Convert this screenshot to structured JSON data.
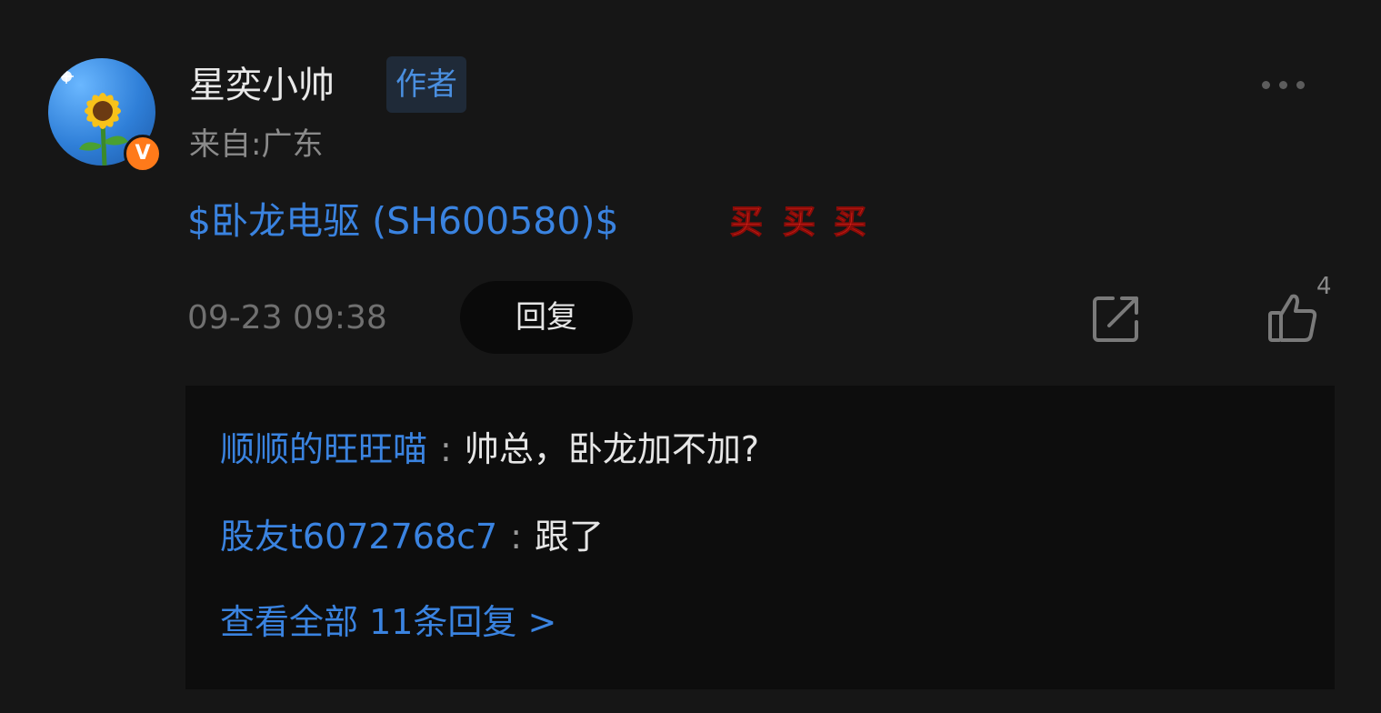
{
  "comment": {
    "username": "星奕小帅",
    "author_badge": "作者",
    "location": "来自:广东",
    "stock_link": "$卧龙电驱 (SH600580)$",
    "emoji": [
      "买",
      "买",
      "买"
    ],
    "timestamp": "09-23 09:38",
    "reply_label": "回复",
    "like_count": "4",
    "verified_badge": "V"
  },
  "replies": [
    {
      "user": "顺顺的旺旺喵",
      "sep": ":",
      "text": "帅总，卧龙加不加?"
    },
    {
      "user": "股友t6072768c7",
      "sep": ":",
      "text": "跟了"
    }
  ],
  "view_all_replies": "查看全部 11条回复 >",
  "colors": {
    "background": "#161616",
    "link_blue": "#3a83e0",
    "reply_box_bg": "#0d0d0d",
    "badge_orange": "#ff7a1a"
  },
  "icons": [
    "more-icon",
    "share-icon",
    "thumbs-up-icon",
    "buy-emoji-icon",
    "verified-icon"
  ]
}
